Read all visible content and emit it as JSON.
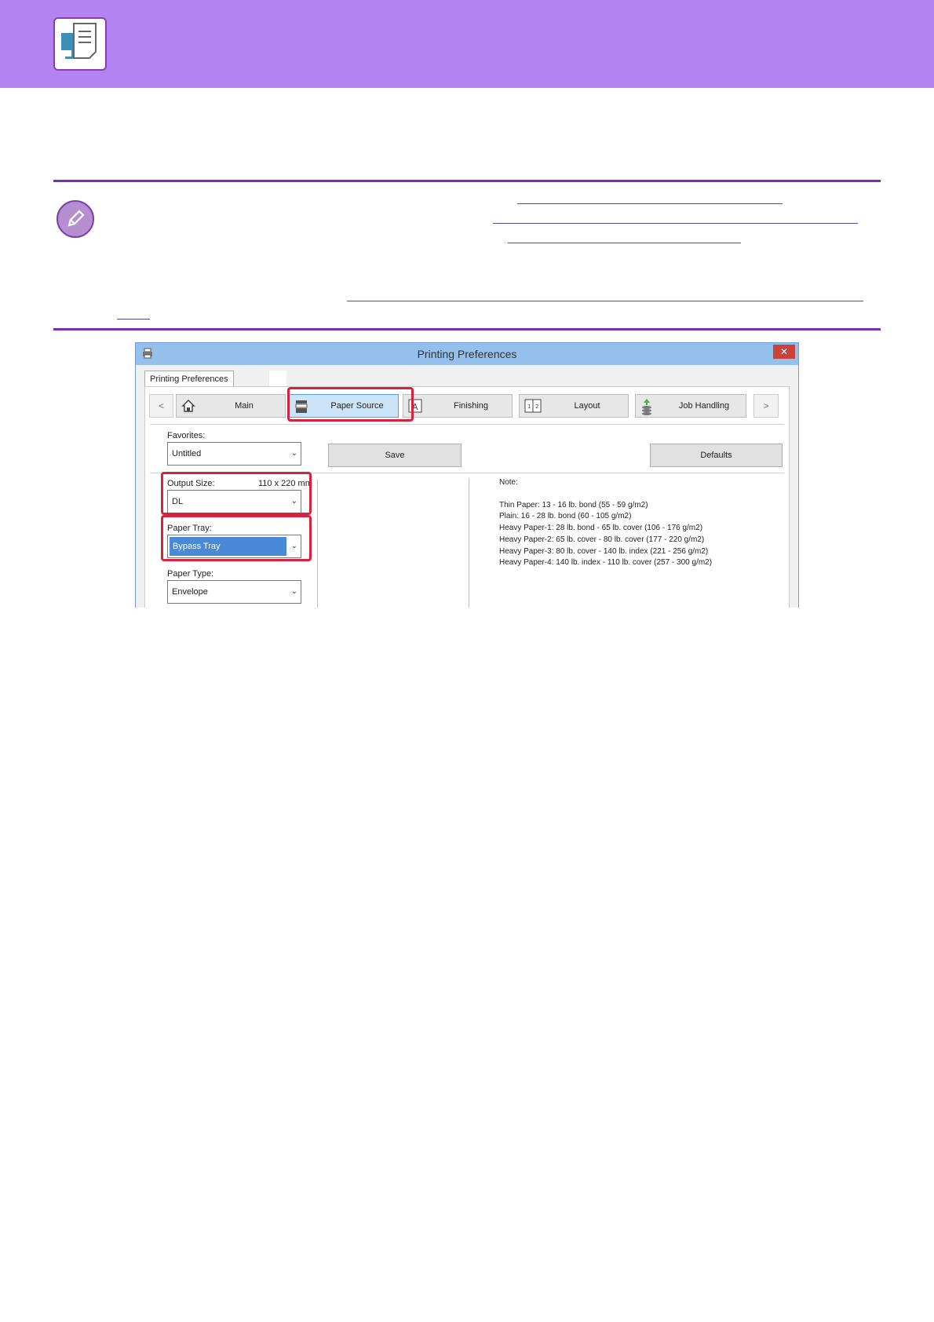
{
  "dialog": {
    "title": "Printing Preferences",
    "close_glyph": "✕",
    "outer_tab": "Printing Preferences",
    "nav": {
      "prev": "<",
      "next": ">",
      "tabs": [
        {
          "label": "Main",
          "icon": "home-icon"
        },
        {
          "label": "Paper Source",
          "icon": "paper-tray-icon",
          "active": true
        },
        {
          "label": "Finishing",
          "icon": "finishing-icon"
        },
        {
          "label": "Layout",
          "icon": "layout-icon"
        },
        {
          "label": "Job Handling",
          "icon": "job-handling-icon"
        }
      ]
    },
    "favorites": {
      "label": "Favorites:",
      "value": "Untitled"
    },
    "save_button": "Save",
    "defaults_button": "Defaults",
    "output_size": {
      "label": "Output Size:",
      "dimension": "110 x 220 mm",
      "value": "DL"
    },
    "paper_tray": {
      "label": "Paper Tray:",
      "value": "Bypass Tray"
    },
    "paper_type": {
      "label": "Paper Type:",
      "value": "Envelope"
    },
    "note": {
      "label": "Note:",
      "lines": [
        "Thin Paper: 13 - 16 lb. bond (55 - 59 g/m2)",
        "Plain: 16 - 28 lb. bond (60 - 105 g/m2)",
        "Heavy Paper-1: 28 lb. bond - 65 lb. cover (106 - 176 g/m2)",
        "Heavy Paper-2: 65 lb. cover - 80 lb. cover (177 - 220 g/m2)",
        "Heavy Paper-3: 80 lb. cover - 140 lb. index (221 - 256 g/m2)",
        "Heavy Paper-4: 140 lb. index - 110 lb. cover (257 - 300 g/m2)"
      ]
    }
  },
  "colors": {
    "header_band": "#b283f1",
    "rule": "#7a2fb2",
    "highlight": "#d6223e",
    "selection": "#4a89d6"
  }
}
